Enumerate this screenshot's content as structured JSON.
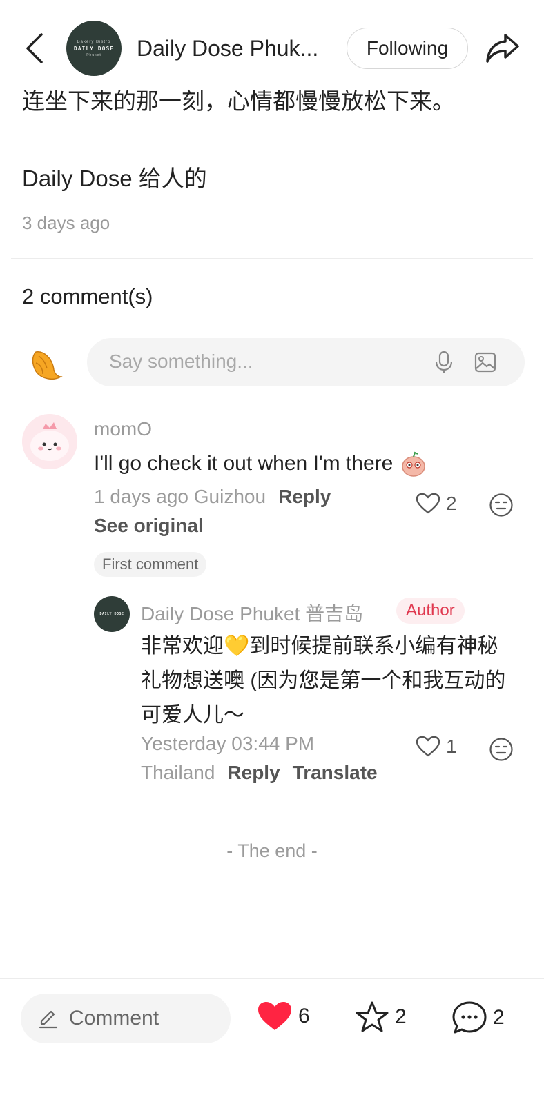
{
  "header": {
    "account_name": "Daily Dose Phuk...",
    "follow_label": "Following",
    "avatar_text": [
      "Bakery Bistro",
      "DAILY DOSE",
      "Phuket"
    ]
  },
  "post": {
    "lines": [
      "连坐下来的那一刻，心情都慢慢放松下来。",
      "Daily Dose 给人的"
    ],
    "date": "3 days ago"
  },
  "comments_section": {
    "count_label": "2 comment(s)",
    "input_placeholder": "Say something..."
  },
  "comment": {
    "author": "momO",
    "text": "I'll go check it out when I'm there",
    "meta": "1 days ago Guizhou",
    "reply_label": "Reply",
    "see_original_label": "See original",
    "likes": "2",
    "badge": "First comment"
  },
  "reply": {
    "author": "Daily Dose Phuket 普吉岛",
    "author_badge": "Author",
    "text_lines": [
      "非常欢迎💛到时候提前联系小编有神秘",
      "礼物想送噢 (因为您是第一个和我互动的",
      "可爱人儿～"
    ],
    "date": "Yesterday 03:44 PM",
    "location": "Thailand",
    "reply_label": "Reply",
    "translate_label": "Translate",
    "likes": "1"
  },
  "end_label": "- The end -",
  "bottom_bar": {
    "comment_label": "Comment",
    "likes": "6",
    "stars": "2",
    "comments": "2"
  },
  "colors": {
    "like_red": "#ff2442",
    "author_badge": "#e0384f",
    "avatar_dark": "#2f3d38"
  }
}
